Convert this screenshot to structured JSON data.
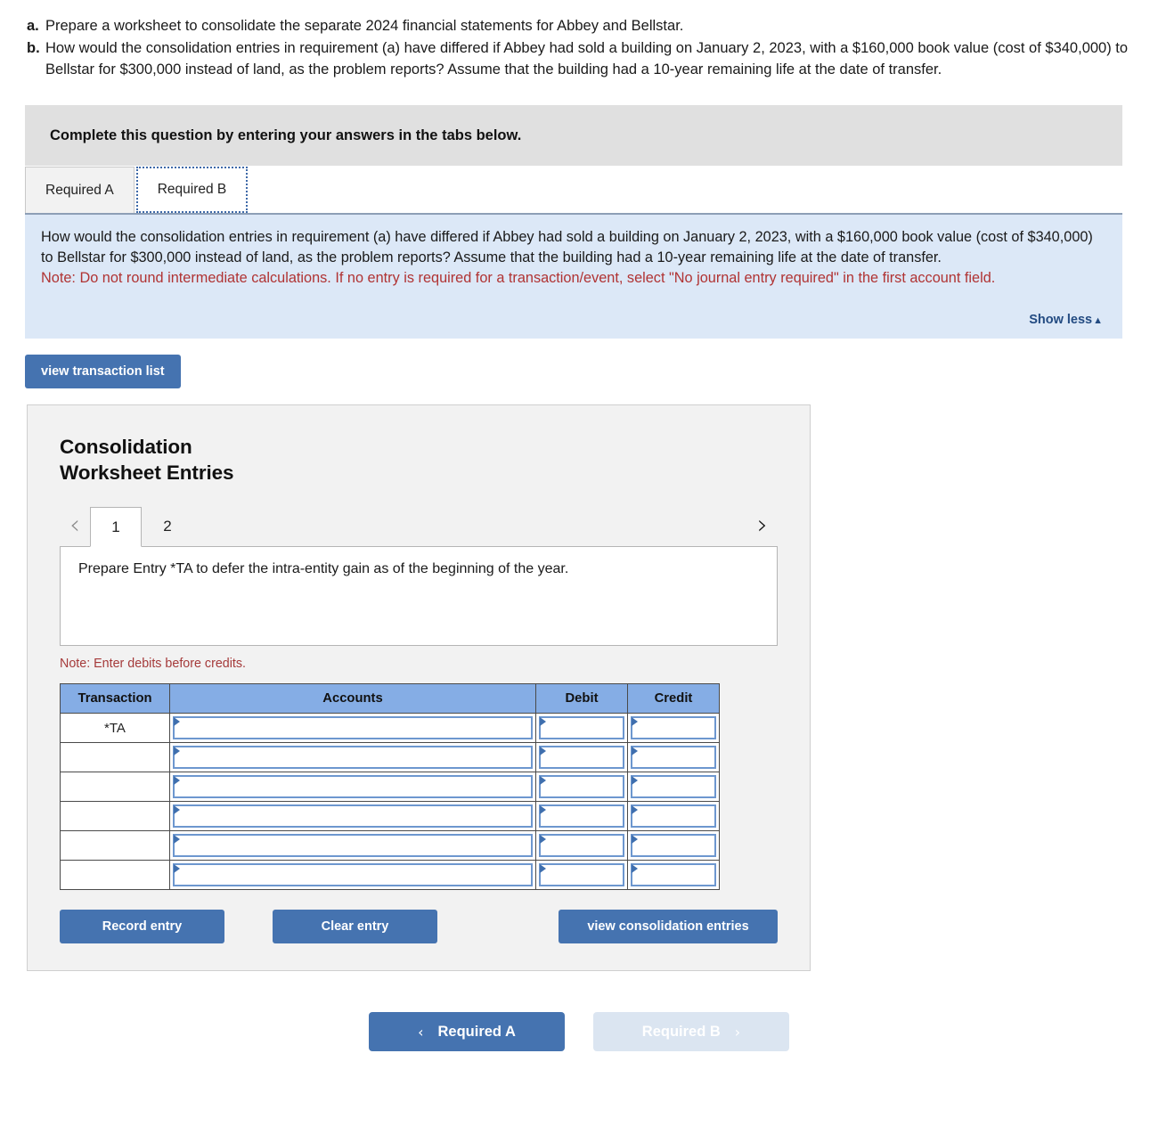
{
  "stem": {
    "items": [
      {
        "letter": "a.",
        "text": "Prepare a worksheet to consolidate the separate 2024 financial statements for Abbey and Bellstar."
      },
      {
        "letter": "b.",
        "text": "How would the consolidation entries in requirement (a) have differed if Abbey had sold a building on January 2, 2023, with a $160,000 book value (cost of $340,000) to Bellstar for $300,000 instead of land, as the problem reports? Assume that the building had a 10-year remaining life at the date of transfer."
      }
    ]
  },
  "banner": {
    "text": "Complete this question by entering your answers in the tabs below."
  },
  "tabs": [
    {
      "label": "Required A",
      "active": false
    },
    {
      "label": "Required B",
      "active": true
    }
  ],
  "info": {
    "question": "How would the consolidation entries in requirement (a) have differed if Abbey had sold a building on January 2, 2023, with a $160,000 book value (cost of $340,000) to Bellstar for $300,000 instead of land, as the problem reports? Assume that the building had a 10-year remaining life at the date of transfer.",
    "note": "Note: Do not round intermediate calculations. If no entry is required for a transaction/event, select \"No journal entry required\" in the first account field.",
    "show_less_label": "Show less",
    "show_less_caret": "▲"
  },
  "view_transaction_list_label": "view transaction list",
  "worksheet": {
    "title_line1": "Consolidation",
    "title_line2": "Worksheet Entries",
    "pager": {
      "prev_icon": "‹",
      "next_icon": "›",
      "pages": [
        {
          "label": "1",
          "active": true
        },
        {
          "label": "2",
          "active": false
        }
      ]
    },
    "entry_description": "Prepare Entry *TA to defer the intra-entity gain as of the beginning of the year.",
    "debit_note": "Note: Enter debits before credits.",
    "table": {
      "columns": [
        "Transaction",
        "Accounts",
        "Debit",
        "Credit"
      ],
      "rows": [
        {
          "transaction": "*TA",
          "accounts": "",
          "debit": "",
          "credit": ""
        },
        {
          "transaction": "",
          "accounts": "",
          "debit": "",
          "credit": ""
        },
        {
          "transaction": "",
          "accounts": "",
          "debit": "",
          "credit": ""
        },
        {
          "transaction": "",
          "accounts": "",
          "debit": "",
          "credit": ""
        },
        {
          "transaction": "",
          "accounts": "",
          "debit": "",
          "credit": ""
        },
        {
          "transaction": "",
          "accounts": "",
          "debit": "",
          "credit": ""
        }
      ]
    },
    "buttons": {
      "record_entry": "Record entry",
      "clear_entry": "Clear entry",
      "view_consolidation_entries": "view consolidation entries"
    }
  },
  "bottom_nav": {
    "prev_label": "Required A",
    "prev_icon": "‹",
    "next_label": "Required B",
    "next_icon": "›"
  },
  "colors": {
    "accent_blue": "#4573b0",
    "table_header_blue": "#85ade5",
    "info_panel_blue": "#dce8f7",
    "banner_gray": "#e0e0e0",
    "note_red": "#b03333",
    "panel_gray": "#f2f2f2"
  }
}
